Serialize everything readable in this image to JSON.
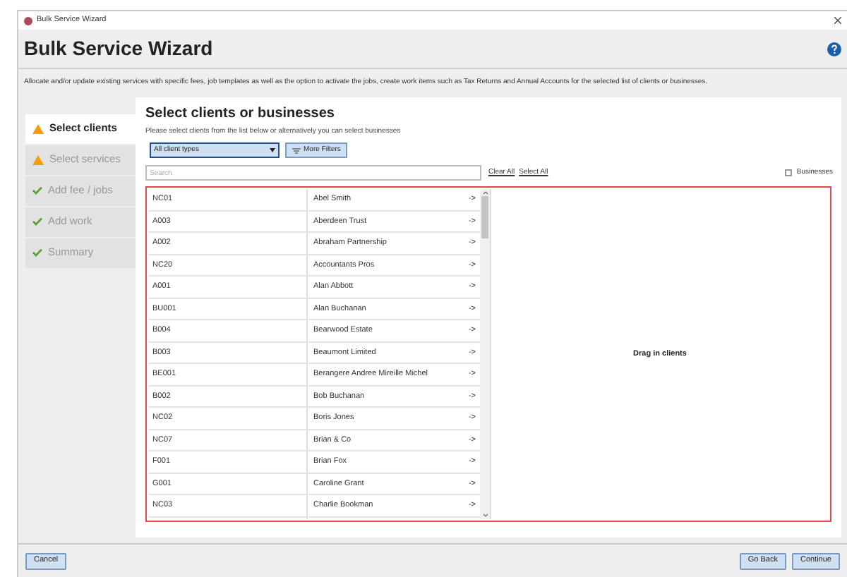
{
  "window": {
    "title": "Bulk Service Wizard"
  },
  "header": {
    "title": "Bulk Service Wizard",
    "description": "Allocate and/or update existing services with specific fees, job templates as well as the option to activate the jobs, create work items such as Tax Returns and Annual Accounts for the selected list of clients or businesses."
  },
  "steps": [
    {
      "label": "Select clients",
      "kind": "warning",
      "selected": true
    },
    {
      "label": "Select services",
      "kind": "warning",
      "selected": false
    },
    {
      "label": "Add fee / jobs",
      "kind": "done",
      "selected": false
    },
    {
      "label": "Add work",
      "kind": "done",
      "selected": false
    },
    {
      "label": "Summary",
      "kind": "done",
      "selected": false
    }
  ],
  "page": {
    "title": "Select clients or businesses",
    "subtitle": "Please select clients from the list below or alternatively you can select businesses",
    "client_type": "All client types",
    "filters_button": "More Filters",
    "search": {
      "placeholder": "Search"
    },
    "clear_all": "Clear All",
    "select_all": "Select All",
    "businesses": {
      "label": "Businesses",
      "checked": false
    },
    "drop_hint": "Drag in clients"
  },
  "clients": [
    {
      "code": "NC01",
      "name": "Abel Smith",
      "action": "->"
    },
    {
      "code": "A003",
      "name": "Aberdeen Trust",
      "action": "->"
    },
    {
      "code": "A002",
      "name": "Abraham Partnership",
      "action": "->"
    },
    {
      "code": "NC20",
      "name": "Accountants Pros",
      "action": "->"
    },
    {
      "code": "A001",
      "name": "Alan Abbott",
      "action": "->"
    },
    {
      "code": "BU001",
      "name": "Alan Buchanan",
      "action": "->"
    },
    {
      "code": "B004",
      "name": "Bearwood Estate",
      "action": "->"
    },
    {
      "code": "B003",
      "name": "Beaumont Limited",
      "action": "->"
    },
    {
      "code": "BE001",
      "name": "Berangere Andree Mireille Michel",
      "action": "->"
    },
    {
      "code": "B002",
      "name": "Bob Buchanan",
      "action": "->"
    },
    {
      "code": "NC02",
      "name": "Boris Jones",
      "action": "->"
    },
    {
      "code": "NC07",
      "name": "Brian & Co",
      "action": "->"
    },
    {
      "code": "F001",
      "name": "Brian Fox",
      "action": "->"
    },
    {
      "code": "G001",
      "name": "Caroline Grant",
      "action": "->"
    },
    {
      "code": "NC03",
      "name": "Charlie Bookman",
      "action": "->"
    }
  ],
  "footer": {
    "cancel": "Cancel",
    "back": "Go Back",
    "continue": "Continue"
  }
}
